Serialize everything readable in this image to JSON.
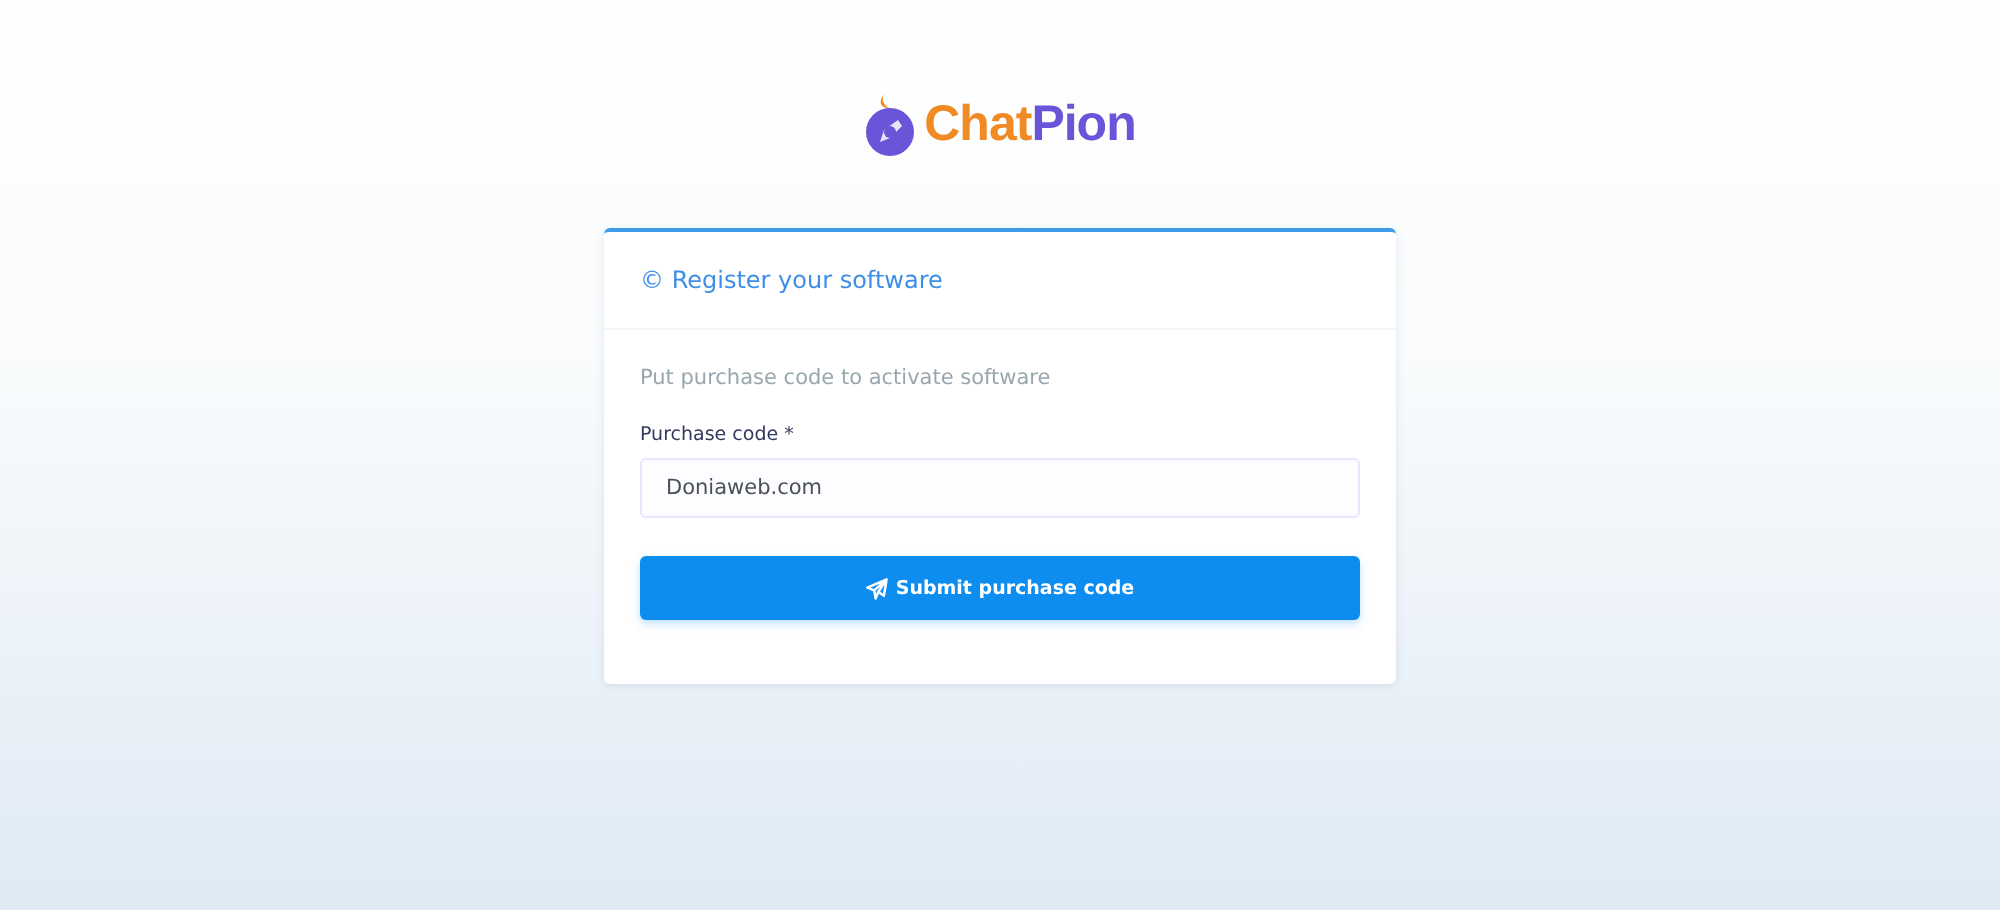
{
  "logo": {
    "parts": [
      "Chat",
      "Pion"
    ]
  },
  "card": {
    "title": "© Register your software",
    "hint": "Put purchase code to activate software",
    "field": {
      "label": "Purchase code *",
      "value": "Doniaweb.com"
    },
    "button": "Submit purchase code"
  }
}
